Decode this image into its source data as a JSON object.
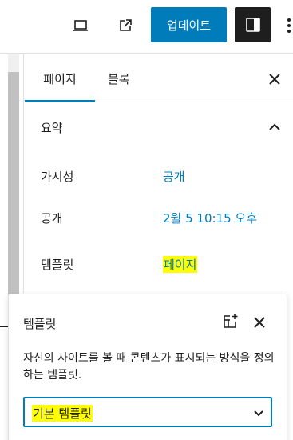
{
  "toolbar": {
    "update_label": "업데이트",
    "icons": [
      "desktop-icon",
      "external-link-icon",
      "sidebar-toggle-icon",
      "more-vertical-icon"
    ]
  },
  "sidebar": {
    "tabs": [
      {
        "label": "페이지",
        "active": true
      },
      {
        "label": "블록",
        "active": false
      }
    ],
    "panel_title": "요약",
    "rows": [
      {
        "label": "가시성",
        "value": "공개"
      },
      {
        "label": "공개",
        "value": "2월 5 10:15 오후"
      },
      {
        "label": "템플릿",
        "value": "페이지"
      }
    ]
  },
  "popover": {
    "title": "템플릿",
    "description": "자신의 사이트를 볼 때 콘텐츠가 표시되는 방식을 정의하는 템플릿.",
    "select_value": "기본 템플릿"
  },
  "colors": {
    "accent": "#007cba",
    "dark": "#1e1e1e",
    "highlight": "#ffff00"
  }
}
